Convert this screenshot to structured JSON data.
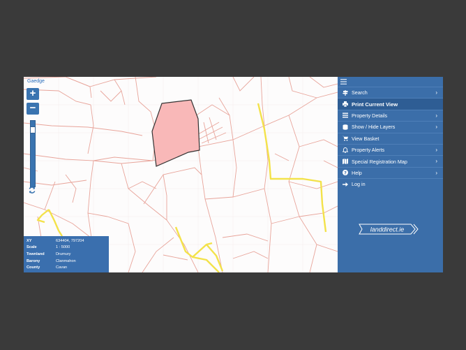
{
  "map": {
    "language_link": "Gaedge",
    "zoom_in": "+",
    "zoom_out": "−"
  },
  "info": {
    "rows": [
      {
        "key": "XY",
        "value": "634404, 797204"
      },
      {
        "key": "Scale",
        "value": "1 : 5000"
      },
      {
        "key": "Townland",
        "value": "Drumury"
      },
      {
        "key": "Barony",
        "value": "Clanmahon"
      },
      {
        "key": "County",
        "value": "Cavan"
      }
    ]
  },
  "sidebar": {
    "items": [
      {
        "label": "Search",
        "icon": "signpost-icon",
        "chevron": "›"
      },
      {
        "label": "Print Current View",
        "icon": "print-icon",
        "chevron": ""
      },
      {
        "label": "Property Details",
        "icon": "list-icon",
        "chevron": "›"
      },
      {
        "label": "Show / Hide Layers",
        "icon": "layers-icon",
        "chevron": "›"
      },
      {
        "label": "View Basket",
        "icon": "cart-icon",
        "chevron": ""
      },
      {
        "label": "Property Alerts",
        "icon": "bell-icon",
        "chevron": "›"
      },
      {
        "label": "Special Registration Map",
        "icon": "map-icon",
        "chevron": "›"
      },
      {
        "label": "Help",
        "icon": "help-icon",
        "chevron": "›"
      },
      {
        "label": "Log in",
        "icon": "login-icon",
        "chevron": ""
      }
    ],
    "logo_text": "landdirect.ie"
  },
  "colors": {
    "sidebar_bg": "#3b6ea9",
    "parcel_line": "#e8a49a",
    "road": "#f3e24a",
    "selected_fill": "#f9b8b8",
    "selected_stroke": "#333333"
  }
}
